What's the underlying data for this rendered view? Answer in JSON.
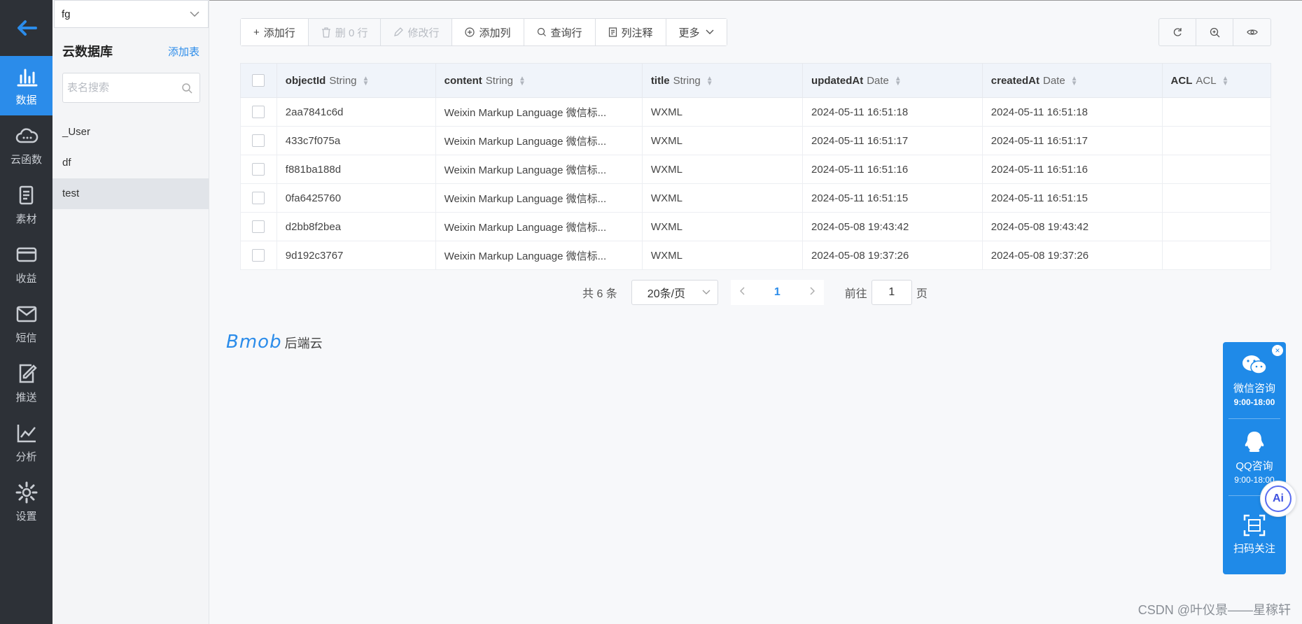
{
  "colors": {
    "accent": "#2b8cea",
    "rail_bg": "#2d3137",
    "float_bg": "#1f8ae8"
  },
  "rail": {
    "items": [
      {
        "label": "数据",
        "icon": "bar-chart-icon",
        "active": true
      },
      {
        "label": "云函数",
        "icon": "cloud-icon"
      },
      {
        "label": "素材",
        "icon": "document-icon"
      },
      {
        "label": "收益",
        "icon": "card-icon"
      },
      {
        "label": "短信",
        "icon": "mail-icon"
      },
      {
        "label": "推送",
        "icon": "edit-icon"
      },
      {
        "label": "分析",
        "icon": "line-chart-icon"
      },
      {
        "label": "设置",
        "icon": "gear-icon"
      }
    ]
  },
  "sidebar": {
    "selected_db": "fg",
    "title": "云数据库",
    "add_table": "添加表",
    "search_placeholder": "表名搜索",
    "tables": [
      "_User",
      "df",
      "test"
    ],
    "active_table": "test"
  },
  "toolbar": {
    "add_row": "添加行",
    "delete_rows": "删 0 行",
    "edit_row": "修改行",
    "add_column": "添加列",
    "query_row": "查询行",
    "column_comment": "列注释",
    "more": "更多"
  },
  "grid": {
    "columns": [
      {
        "name": "objectId",
        "type": "String"
      },
      {
        "name": "content",
        "type": "String"
      },
      {
        "name": "title",
        "type": "String"
      },
      {
        "name": "updatedAt",
        "type": "Date"
      },
      {
        "name": "createdAt",
        "type": "Date"
      },
      {
        "name": "ACL",
        "type": "ACL"
      }
    ],
    "rows": [
      {
        "objectId": "2aa7841c6d",
        "content": "Weixin Markup Language 微信标...",
        "title": "WXML",
        "updatedAt": "2024-05-11 16:51:18",
        "createdAt": "2024-05-11 16:51:18",
        "ACL": ""
      },
      {
        "objectId": "433c7f075a",
        "content": "Weixin Markup Language 微信标...",
        "title": "WXML",
        "updatedAt": "2024-05-11 16:51:17",
        "createdAt": "2024-05-11 16:51:17",
        "ACL": ""
      },
      {
        "objectId": "f881ba188d",
        "content": "Weixin Markup Language 微信标...",
        "title": "WXML",
        "updatedAt": "2024-05-11 16:51:16",
        "createdAt": "2024-05-11 16:51:16",
        "ACL": ""
      },
      {
        "objectId": "0fa6425760",
        "content": "Weixin Markup Language 微信标...",
        "title": "WXML",
        "updatedAt": "2024-05-11 16:51:15",
        "createdAt": "2024-05-11 16:51:15",
        "ACL": ""
      },
      {
        "objectId": "d2bb8f2bea",
        "content": "Weixin Markup Language 微信标...",
        "title": "WXML",
        "updatedAt": "2024-05-08 19:43:42",
        "createdAt": "2024-05-08 19:43:42",
        "ACL": ""
      },
      {
        "objectId": "9d192c3767",
        "content": "Weixin Markup Language 微信标...",
        "title": "WXML",
        "updatedAt": "2024-05-08 19:37:26",
        "createdAt": "2024-05-08 19:37:26",
        "ACL": ""
      }
    ]
  },
  "pager": {
    "total": "共 6 条",
    "page_size": "20条/页",
    "current_page": "1",
    "goto_label": "前往",
    "goto_value": "1",
    "goto_suffix": "页"
  },
  "brand": {
    "logo": "Bmob",
    "name": "后端云"
  },
  "float_widget": {
    "wechat_label": "微信咨询",
    "wechat_hours": "9:00-18:00",
    "qq_label": "QQ咨询",
    "qq_hours": "9:00-18:00",
    "scan_label": "扫码关注",
    "ai_label": "Ai"
  },
  "watermark": "CSDN @叶仪景——星稼轩"
}
